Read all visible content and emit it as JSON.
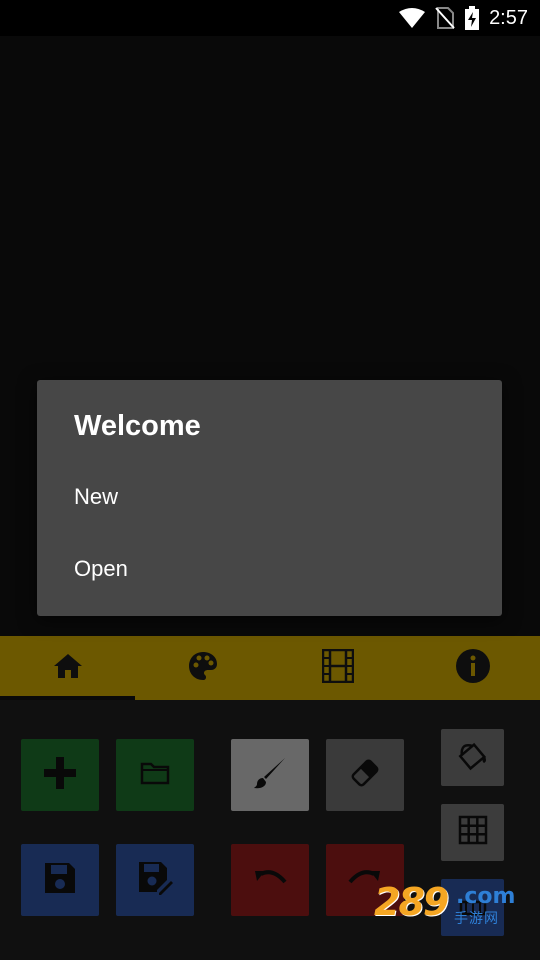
{
  "status_bar": {
    "time": "2:57",
    "icons": [
      "wifi-icon",
      "no-sim-icon",
      "battery-charging-icon"
    ]
  },
  "dialog": {
    "title": "Welcome",
    "items": [
      {
        "label": "New"
      },
      {
        "label": "Open"
      }
    ]
  },
  "tabs": [
    {
      "icon": "home-icon",
      "selected": true
    },
    {
      "icon": "palette-icon",
      "selected": false
    },
    {
      "icon": "film-icon",
      "selected": false
    },
    {
      "icon": "info-icon",
      "selected": false
    }
  ],
  "tools": [
    {
      "icon": "plus-icon",
      "color": "#1c6b2b"
    },
    {
      "icon": "folder-icon",
      "color": "#1c6b2b"
    },
    {
      "icon": "brush-icon",
      "color": "#bdbdbd"
    },
    {
      "icon": "eraser-icon",
      "color": "#6a6a6a"
    },
    {
      "icon": "fill-bucket-icon",
      "color": "#6e6e6e"
    },
    {
      "icon": "grid-icon",
      "color": "#6e6e6e"
    },
    {
      "icon": "save-icon",
      "color": "#2d4f9a"
    },
    {
      "icon": "save-as-icon",
      "color": "#2d4f9a"
    },
    {
      "icon": "undo-icon",
      "color": "#8a1b1b"
    },
    {
      "icon": "redo-icon",
      "color": "#8a1b1b"
    }
  ],
  "watermark": {
    "number": "289",
    "suffix": ".com",
    "chinese": "手游网"
  },
  "colors": {
    "tab_bar": "#c5a000",
    "dialog_bg": "#474747",
    "tool_panel_bg": "#1e1e1e"
  }
}
